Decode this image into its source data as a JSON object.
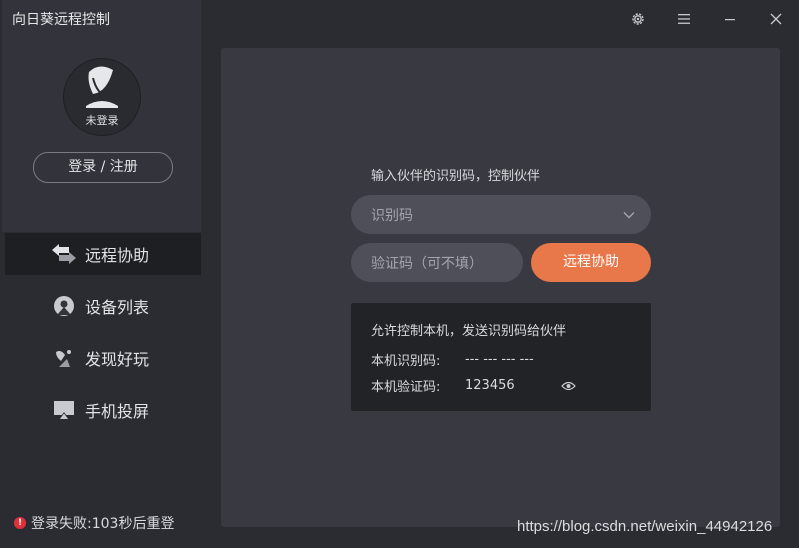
{
  "app": {
    "title": "向日葵远程控制"
  },
  "account": {
    "avatar_label": "未登录",
    "login_button": "登录 / 注册"
  },
  "sidebar": {
    "items": [
      {
        "label": "远程协助",
        "icon": "remote-assist-icon",
        "active": true
      },
      {
        "label": "设备列表",
        "icon": "device-list-icon",
        "active": false
      },
      {
        "label": "发现好玩",
        "icon": "discover-icon",
        "active": false
      },
      {
        "label": "手机投屏",
        "icon": "phone-cast-icon",
        "active": false
      }
    ]
  },
  "status": {
    "login_error": "登录失败:103秒后重登"
  },
  "main": {
    "title": "输入伙伴的识别码，控制伙伴",
    "id_select_placeholder": "识别码",
    "code_placeholder": "验证码（可不填）",
    "assist_button": "远程协助",
    "info": {
      "title": "允许控制本机，发送识别码给伙伴",
      "id_label": "本机识别码:",
      "id_value": "--- --- --- ---",
      "code_label": "本机验证码:",
      "code_value": "123456"
    }
  },
  "watermark": "https://blog.csdn.net/weixin_44942126",
  "colors": {
    "accent": "#e8774a",
    "panel": "#393a41",
    "sidebar_active": "#1e1f22",
    "error": "#e0303a"
  }
}
